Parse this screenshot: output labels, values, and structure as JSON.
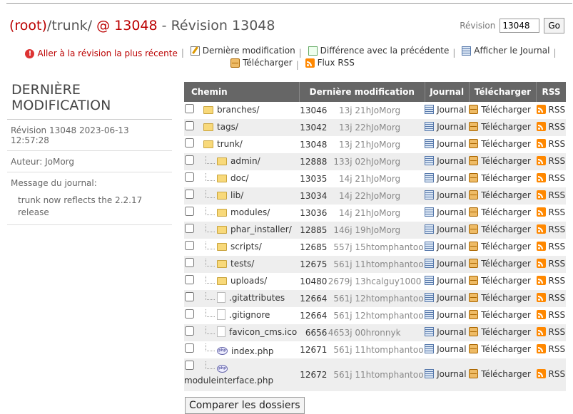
{
  "header": {
    "root": "(root)",
    "path": "/trunk/",
    "at": "@",
    "rev": "13048",
    "suffix": "- Révision 13048"
  },
  "rev_form": {
    "label": "Révision",
    "value": "13048",
    "go": "Go"
  },
  "links": [
    {
      "icon": "warning-icon",
      "label": "Aller à la révision la plus récente",
      "color": "#bb0000"
    },
    {
      "icon": "edit-icon",
      "label": "Dernière modification"
    },
    {
      "icon": "diff-icon",
      "label": "Différence avec la précédente"
    },
    {
      "icon": "log-icon",
      "label": "Afficher le Journal"
    },
    {
      "icon": "download-icon",
      "label": "Télécharger"
    },
    {
      "icon": "rss-icon",
      "label": "Flux RSS"
    }
  ],
  "sidebar": {
    "title_line1": "DERNIÈRE",
    "title_line2": "MODIFICATION",
    "revision": "Révision 13048 2023-06-13 12:57:28",
    "author": "Auteur: JoMorg",
    "message_label": "Message du journal:",
    "message": "trunk now reflects the 2.2.17 release"
  },
  "table": {
    "headers": [
      "Chemin",
      "Dernière modification",
      "Journal",
      "Télécharger",
      "RSS"
    ],
    "action_labels": {
      "log": "Journal",
      "download": "Télécharger",
      "rss": "RSS"
    },
    "rows": [
      {
        "name": "branches/",
        "type": "folder",
        "depth": 0,
        "rev": "13046",
        "age": "13j 21h",
        "author": "JoMorg"
      },
      {
        "name": "tags/",
        "type": "folder",
        "depth": 0,
        "rev": "13042",
        "age": "13j 22h",
        "author": "JoMorg"
      },
      {
        "name": "trunk/",
        "type": "folder",
        "depth": 0,
        "rev": "13048",
        "age": "13j 21h",
        "author": "JoMorg"
      },
      {
        "name": "admin/",
        "type": "folder",
        "depth": 1,
        "rev": "12888",
        "age": "133j 02h",
        "author": "JoMorg"
      },
      {
        "name": "doc/",
        "type": "folder",
        "depth": 1,
        "rev": "13035",
        "age": "14j 21h",
        "author": "JoMorg"
      },
      {
        "name": "lib/",
        "type": "folder",
        "depth": 1,
        "rev": "13034",
        "age": "14j 22h",
        "author": "JoMorg"
      },
      {
        "name": "modules/",
        "type": "folder",
        "depth": 1,
        "rev": "13036",
        "age": "14j 21h",
        "author": "JoMorg"
      },
      {
        "name": "phar_installer/",
        "type": "folder",
        "depth": 1,
        "rev": "12885",
        "age": "146j 19h",
        "author": "JoMorg"
      },
      {
        "name": "scripts/",
        "type": "folder",
        "depth": 1,
        "rev": "12685",
        "age": "557j 15h",
        "author": "tomphantoo"
      },
      {
        "name": "tests/",
        "type": "folder",
        "depth": 1,
        "rev": "12675",
        "age": "561j 11h",
        "author": "tomphantoo"
      },
      {
        "name": "uploads/",
        "type": "folder",
        "depth": 1,
        "rev": "10480",
        "age": "2679j 13h",
        "author": "calguy1000"
      },
      {
        "name": ".gitattributes",
        "type": "file",
        "depth": 1,
        "rev": "12664",
        "age": "561j 12h",
        "author": "tomphantoo"
      },
      {
        "name": ".gitignore",
        "type": "file",
        "depth": 1,
        "rev": "12664",
        "age": "561j 12h",
        "author": "tomphantoo"
      },
      {
        "name": "favicon_cms.ico",
        "type": "file",
        "depth": 1,
        "rev": "6656",
        "age": "4653j 00h",
        "author": "ronnyk"
      },
      {
        "name": "index.php",
        "type": "php",
        "depth": 1,
        "rev": "12671",
        "age": "561j 11h",
        "author": "tomphantoo"
      },
      {
        "name": "moduleinterface.php",
        "type": "php",
        "depth": 1,
        "rev": "12672",
        "age": "561j 11h",
        "author": "tomphantoo"
      }
    ]
  },
  "compare_button": "Comparer les dossiers"
}
